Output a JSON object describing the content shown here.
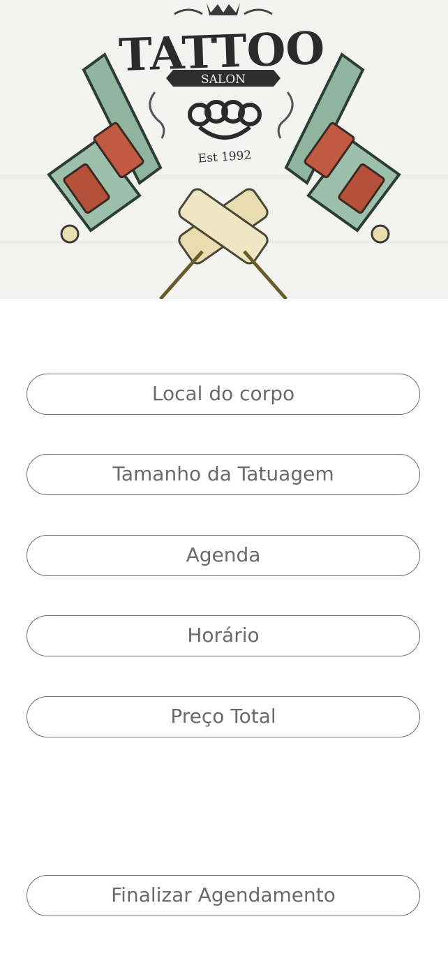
{
  "banner": {
    "logo_text_main": "TATTOO",
    "logo_text_ribbon": "SALON",
    "logo_text_est": "Est 1992",
    "icon": "tattoo-machines-logo"
  },
  "form": {
    "fields": [
      {
        "label": "Local do corpo"
      },
      {
        "label": "Tamanho da Tatuagem"
      },
      {
        "label": "Agenda"
      },
      {
        "label": "Horário"
      },
      {
        "label": "Preço Total"
      }
    ]
  },
  "actions": {
    "finalize_label": "Finalizar Agendamento"
  },
  "colors": {
    "border": "#6e6e6e",
    "text": "#6a6a6a",
    "machine_green": "#8fb5a0",
    "coil_copper": "#b5513a",
    "grip_cream": "#e8ddb0"
  }
}
